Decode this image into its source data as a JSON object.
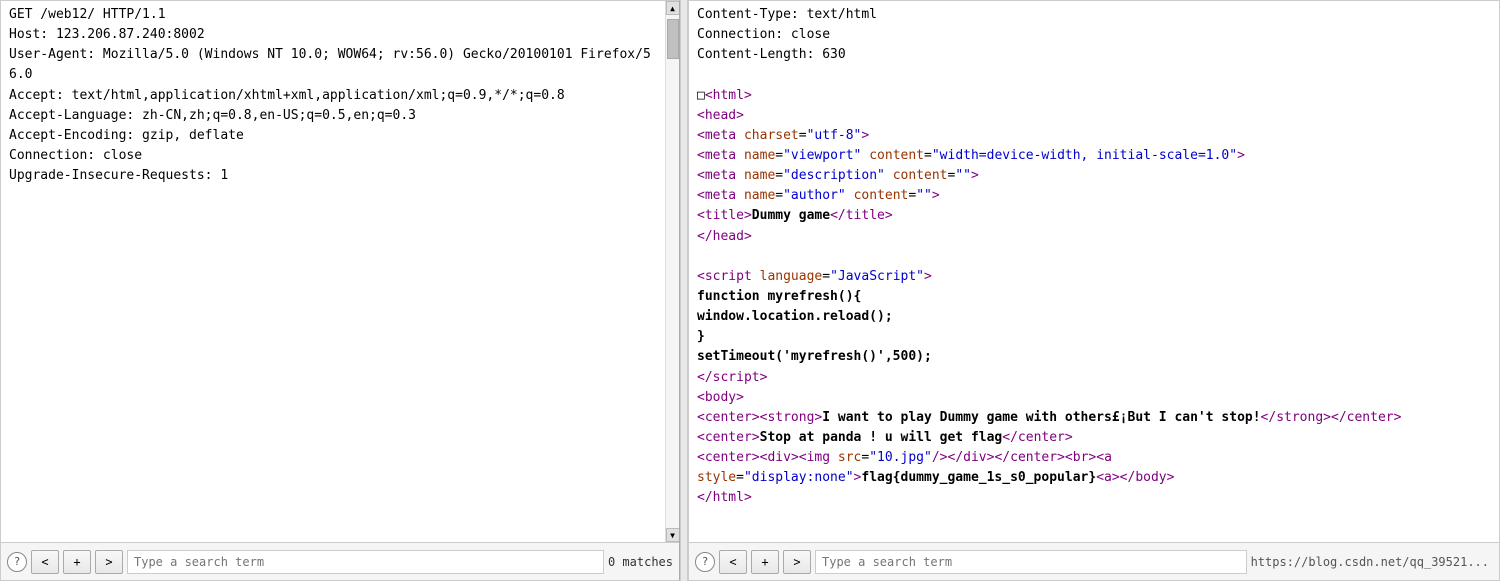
{
  "left_panel": {
    "lines": [
      "GET /web12/ HTTP/1.1",
      "Host: 123.206.87.240:8002",
      "User-Agent: Mozilla/5.0 (Windows NT 10.0; WOW64; rv:56.0) Gecko/20100101 Firefox/56.0",
      "Accept: text/html,application/xhtml+xml,application/xml;q=0.9,*/*;q=0.8",
      "Accept-Language: zh-CN,zh;q=0.8,en-US;q=0.5,en;q=0.3",
      "Accept-Encoding: gzip, deflate",
      "Connection: close",
      "Upgrade-Insecure-Requests: 1"
    ]
  },
  "right_panel": {
    "plain_lines": [
      "Content-Type: text/html",
      "Connection: close",
      "Content-Length: 630"
    ]
  },
  "footer_left": {
    "help_label": "?",
    "prev_label": "<",
    "add_label": "+",
    "next_label": ">",
    "search_placeholder": "Type a search term",
    "matches_label": "0 matches"
  },
  "footer_right": {
    "help_label": "?",
    "prev_label": "<",
    "add_label": "+",
    "next_label": ">",
    "search_placeholder": "Type a search term"
  },
  "status_bar": {
    "url": "https://blog.csdn.net/qq_39521..."
  }
}
